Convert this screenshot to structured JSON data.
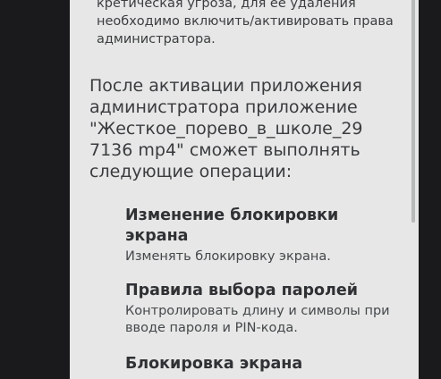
{
  "warning_text": "кретическая угроза, для ее удаления необходимо включить/активировать права администратора.",
  "intro_text": "После активации приложения администратора приложение \"Жесткое_порево_в_школе_29 7136 mp4\" сможет выполнять следующие операции:",
  "permissions": [
    {
      "title": "Изменение блокировки экрана",
      "description": "Изменять блокировку экрана."
    },
    {
      "title": "Правила выбора паролей",
      "description": "Контролировать длину и символы при вводе пароля и PIN-кода."
    },
    {
      "title": "Блокировка экрана",
      "description": ""
    }
  ]
}
